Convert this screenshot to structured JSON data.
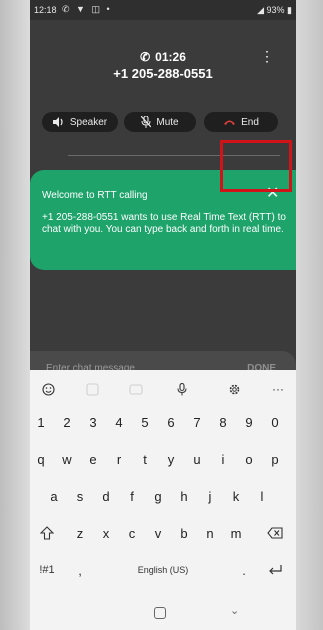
{
  "status": {
    "time": "12:18",
    "battery": "93%"
  },
  "call": {
    "timer": "01:26",
    "number": "+1 205-288-0551",
    "buttons": {
      "speaker": "Speaker",
      "mute": "Mute",
      "end": "End"
    }
  },
  "rtt_banner": {
    "title": "Welcome to RTT calling",
    "body": "+1 205-288-0551 wants to use Real Time Text (RTT) to chat with you. You can type back and forth in real time."
  },
  "chat": {
    "placeholder": "Enter chat message",
    "done": "DONE"
  },
  "keyboard": {
    "row1": [
      "1",
      "2",
      "3",
      "4",
      "5",
      "6",
      "7",
      "8",
      "9",
      "0"
    ],
    "row2": [
      "q",
      "w",
      "e",
      "r",
      "t",
      "y",
      "u",
      "i",
      "o",
      "p"
    ],
    "row3": [
      "a",
      "s",
      "d",
      "f",
      "g",
      "h",
      "j",
      "k",
      "l"
    ],
    "row4": [
      "z",
      "x",
      "c",
      "v",
      "b",
      "n",
      "m"
    ],
    "symbols": "!#1",
    "comma": ",",
    "space": "English (US)",
    "period": "."
  },
  "colors": {
    "banner": "#1ea36b",
    "end_icon": "#e2403a",
    "highlight": "#d2141a"
  }
}
